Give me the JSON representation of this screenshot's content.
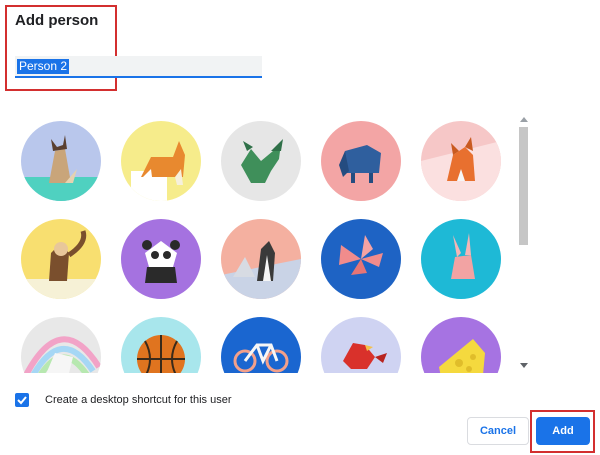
{
  "dialog": {
    "title": "Add person",
    "name_value": "Person 2"
  },
  "avatars": [
    {
      "name": "cat",
      "bg": "#b9c7ec",
      "fg": "#c9a57a"
    },
    {
      "name": "corgi",
      "bg": "#f6ec8b",
      "fg": "#e8892f"
    },
    {
      "name": "dragon",
      "bg": "#e6e6e6",
      "fg": "#3f8f5a"
    },
    {
      "name": "elephant",
      "bg": "#f3a5a5",
      "fg": "#2f5f9e"
    },
    {
      "name": "fox",
      "bg": "#f6c7c7",
      "fg": "#e8702f"
    },
    {
      "name": "monkey",
      "bg": "#f8df70",
      "fg": "#7a4f2d"
    },
    {
      "name": "panda",
      "bg": "#a572e0",
      "fg": "#2a2a2a"
    },
    {
      "name": "penguin",
      "bg": "#f4b0a0",
      "fg": "#3a3a3a"
    },
    {
      "name": "butterfly",
      "bg": "#1e63c4",
      "fg": "#f18c8c"
    },
    {
      "name": "rabbit",
      "bg": "#1eb9d6",
      "fg": "#f2a3a3"
    },
    {
      "name": "unicorn",
      "bg": "#e8e8e8",
      "fg": "#f3f3f3"
    },
    {
      "name": "basketball",
      "bg": "#a8e6ec",
      "fg": "#e0741f"
    },
    {
      "name": "bike",
      "bg": "#1a66d0",
      "fg": "#f3a08a"
    },
    {
      "name": "bird",
      "bg": "#cfd3f2",
      "fg": "#d9312b"
    },
    {
      "name": "cheese",
      "bg": "#a673e2",
      "fg": "#f5d93e"
    }
  ],
  "checkbox": {
    "checked": true,
    "label": "Create a desktop shortcut for this user"
  },
  "buttons": {
    "cancel": "Cancel",
    "add": "Add"
  },
  "colors": {
    "accent": "#1a73e8",
    "highlight": "#d32f2f"
  }
}
